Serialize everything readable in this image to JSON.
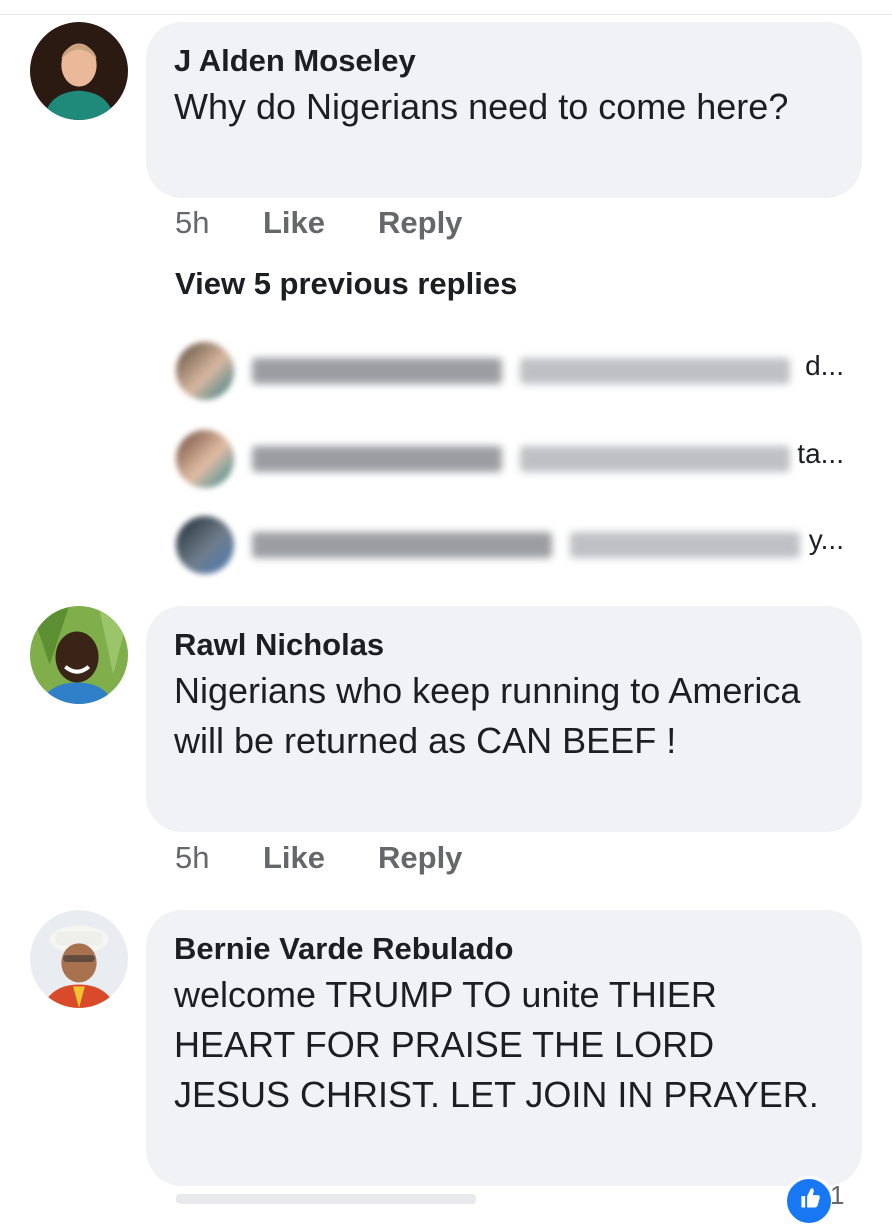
{
  "comments": [
    {
      "author": "J Alden Moseley",
      "text": "Why do Nigerians need to come here?",
      "time": "5h",
      "like_label": "Like",
      "reply_label": "Reply"
    },
    {
      "author": "Rawl Nicholas",
      "text": "Nigerians who keep running to America will be returned as CAN BEEF !",
      "time": "5h",
      "like_label": "Like",
      "reply_label": "Reply"
    },
    {
      "author": "Bernie Varde Rebulado",
      "text": "welcome TRUMP  TO unite THIER HEART FOR PRAISE THE  LORD JESUS  CHRIST. LET JOIN IN PRAYER."
    }
  ],
  "replies": {
    "view_previous_label": "View 5 previous replies",
    "blurred_tails": [
      "d...",
      "ta...",
      "y..."
    ]
  },
  "reaction": {
    "icon": "like-icon",
    "count": "1",
    "color": "#1877f2"
  },
  "colors": {
    "bubble": "#f0f2f5",
    "meta_text": "#65676b",
    "primary_text": "#1c1e21"
  }
}
